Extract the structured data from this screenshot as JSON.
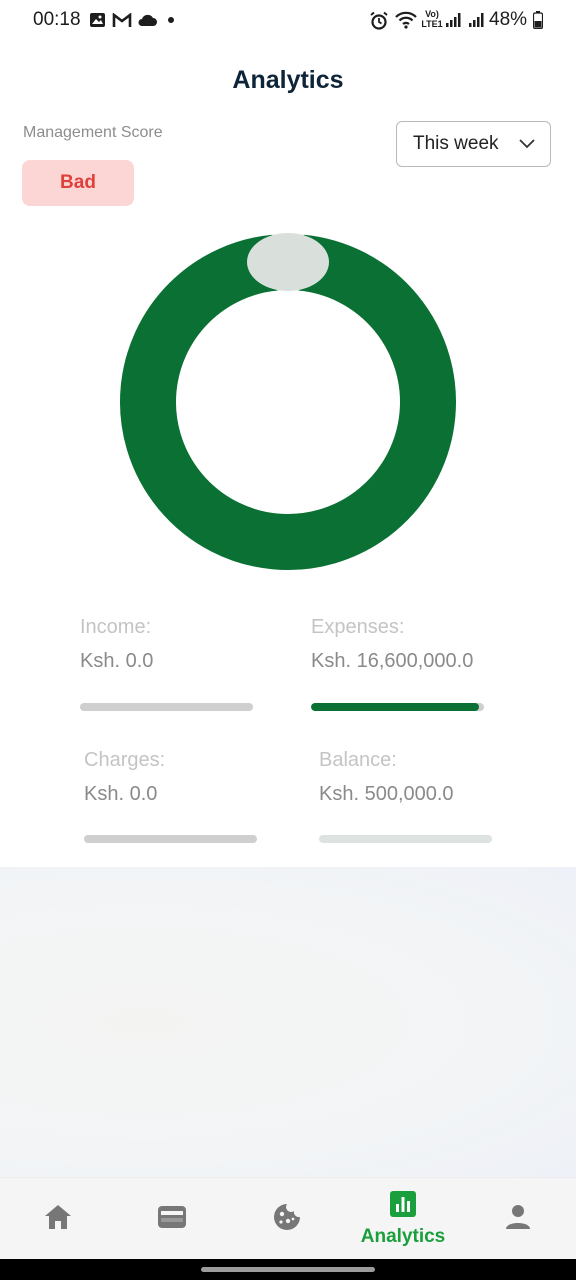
{
  "status": {
    "time": "00:18",
    "battery": "48%",
    "icons": [
      "gallery-icon",
      "gmail-icon",
      "cloud-icon",
      "dot-icon",
      "alarm-icon",
      "wifi-icon",
      "volte-icon",
      "signal-icon",
      "signal-icon",
      "battery-icon"
    ],
    "volte_top": "Vo)",
    "volte_bottom": "LTE1"
  },
  "header": {
    "title": "Analytics"
  },
  "score": {
    "label": "Management Score",
    "value": "Bad",
    "badge_color": "#e0403b"
  },
  "period_select": {
    "selected": "This week"
  },
  "donut": {
    "expenses_fraction": 0.97,
    "balance_fraction": 0.03,
    "colors": {
      "expenses": "#0a7033",
      "balance": "#d9e0dc"
    }
  },
  "stats": {
    "income": {
      "label": "Income:",
      "value": "Ksh. 0.0",
      "progress": 0
    },
    "expenses": {
      "label": "Expenses:",
      "value": "Ksh. 16,600,000.0",
      "progress": 0.97
    },
    "charges": {
      "label": "Charges:",
      "value": "Ksh. 0.0",
      "progress": 0
    },
    "balance": {
      "label": "Balance:",
      "value": "Ksh. 500,000.0",
      "progress": 0
    }
  },
  "nav": {
    "items": [
      {
        "icon": "home-icon"
      },
      {
        "icon": "wallet-icon"
      },
      {
        "icon": "cookie-icon"
      },
      {
        "icon": "analytics-icon",
        "label": "Analytics",
        "active": true
      },
      {
        "icon": "person-icon"
      }
    ],
    "active_color": "#1a9f3c",
    "inactive_color": "#777777"
  }
}
